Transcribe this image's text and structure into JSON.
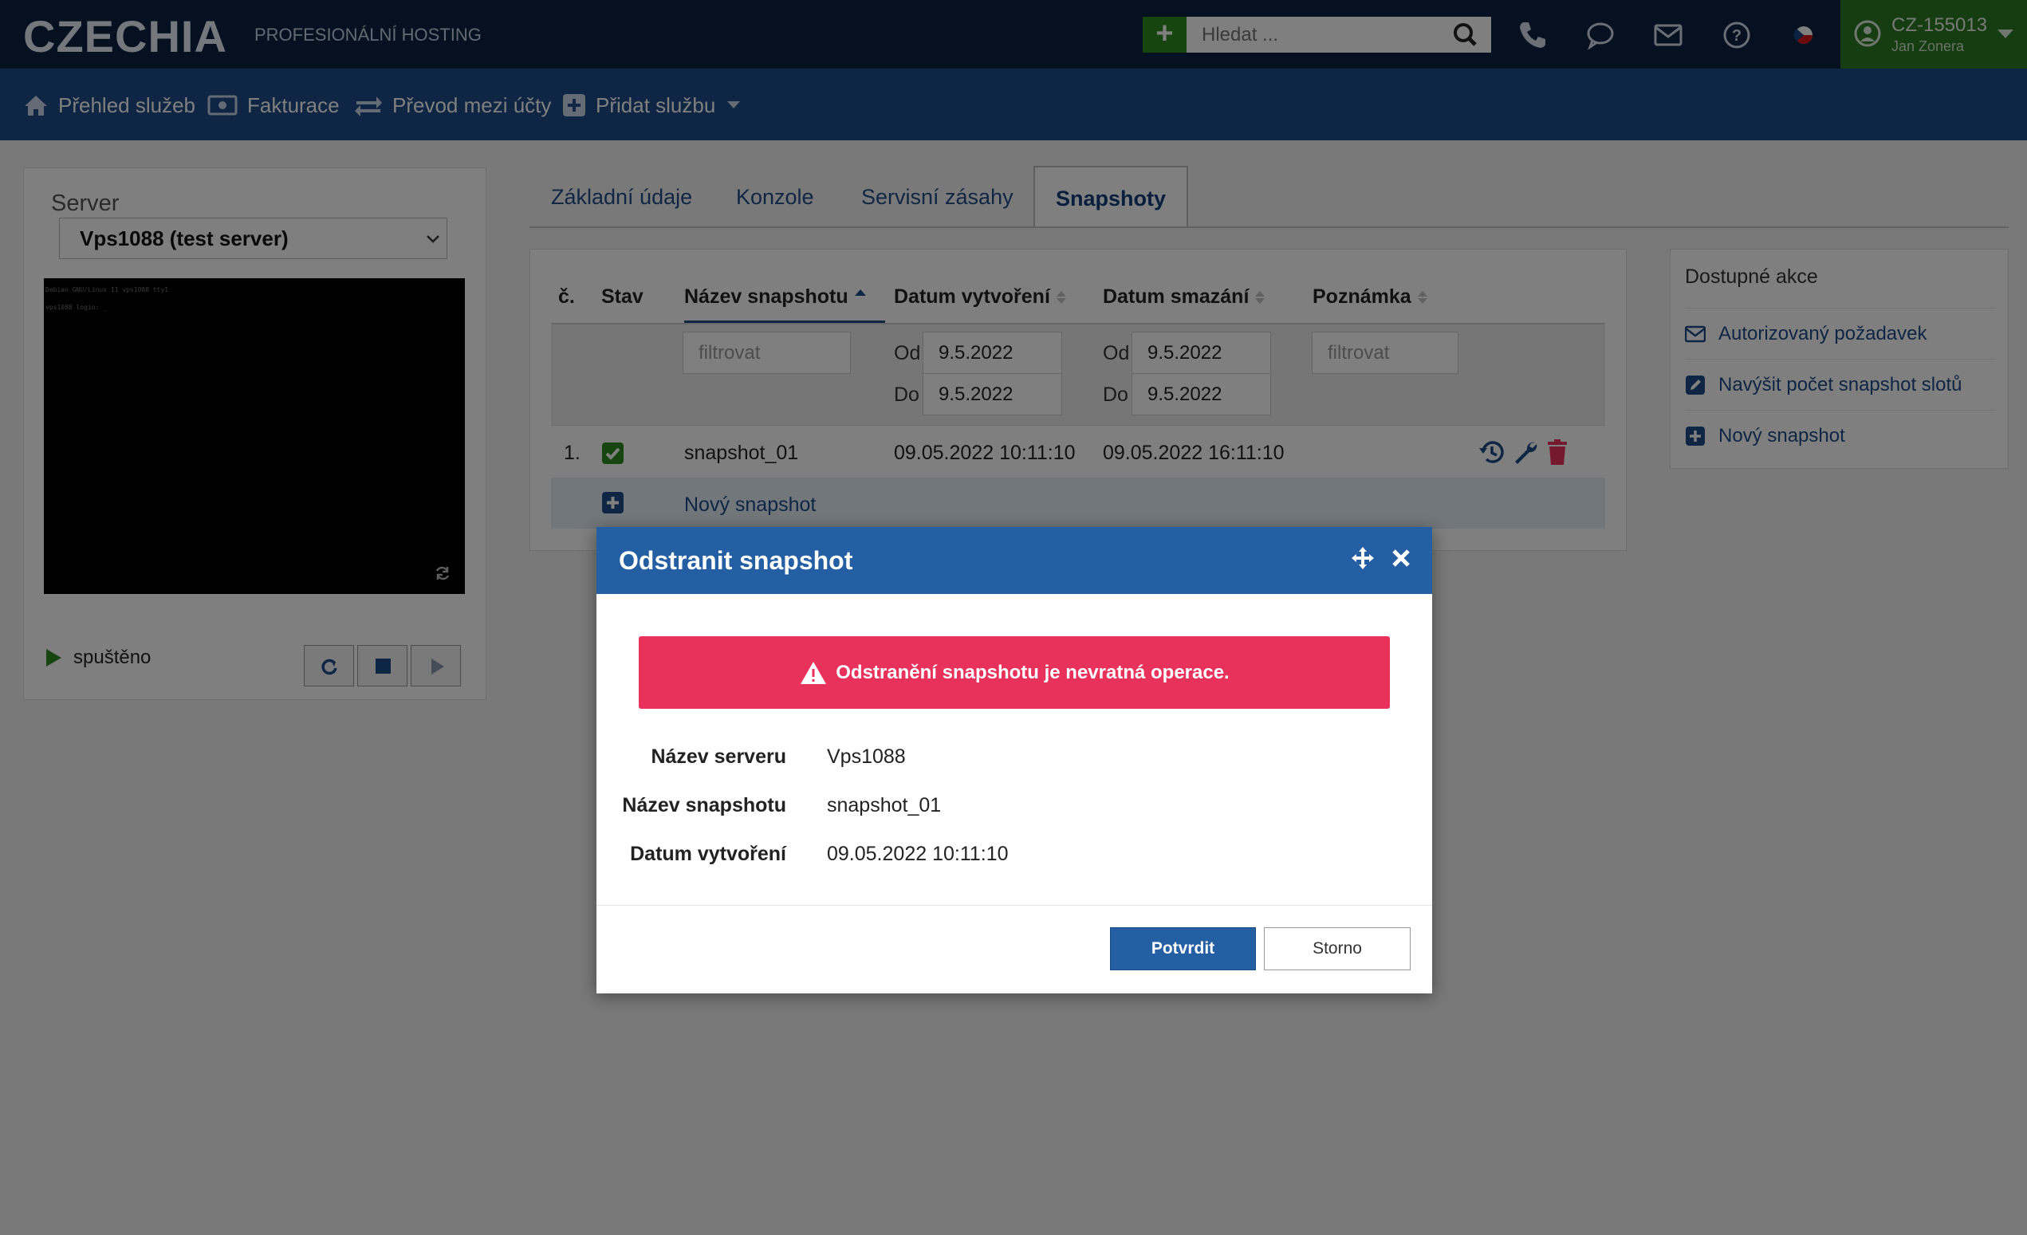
{
  "brand": {
    "name": "CZECHIA",
    "tagline": "PROFESIONÁLNÍ HOSTING"
  },
  "search": {
    "placeholder": "Hledat ..."
  },
  "account": {
    "id": "CZ-155013",
    "name": "Jan Zonera"
  },
  "subnav": {
    "overview": "Přehled služeb",
    "billing": "Fakturace",
    "transfer": "Převod mezi účty",
    "add_service": "Přidat službu"
  },
  "left_panel": {
    "server_label": "Server",
    "server_selected": "Vps1088 (test server)",
    "console_lines": [
      "Debian GNU/Linux 11 vps1088 tty1",
      "vps1088 login: _"
    ],
    "status": "spuštěno"
  },
  "tabs": [
    "Základní údaje",
    "Konzole",
    "Servisní zásahy",
    "Snapshoty"
  ],
  "table": {
    "headers": {
      "num": "č.",
      "status": "Stav",
      "name": "Název snapshotu",
      "created": "Datum vytvoření",
      "deleted": "Datum smazání",
      "note": "Poznámka"
    },
    "filter_placeholder": "filtrovat",
    "from_label": "Od",
    "to_label": "Do",
    "created_from": "9.5.2022",
    "created_to": "9.5.2022",
    "deleted_from": "9.5.2022",
    "deleted_to": "9.5.2022",
    "rows": [
      {
        "num": "1.",
        "name": "snapshot_01",
        "created": "09.05.2022 10:11:10",
        "deleted": "09.05.2022 16:11:10"
      }
    ],
    "new_row_label": "Nový snapshot"
  },
  "actions": {
    "title": "Dostupné akce",
    "items": [
      "Autorizovaný požadavek",
      "Navýšit počet snapshot slotů",
      "Nový snapshot"
    ]
  },
  "modal": {
    "title": "Odstranit snapshot",
    "alert": "Odstranění snapshotu je nevratná operace.",
    "fields": [
      {
        "key": "Název serveru",
        "value": "Vps1088"
      },
      {
        "key": "Název snapshotu",
        "value": "snapshot_01"
      },
      {
        "key": "Datum vytvoření",
        "value": "09.05.2022 10:11:10"
      }
    ],
    "confirm": "Potvrdit",
    "cancel": "Storno"
  },
  "colors": {
    "topbar": "#0b2240",
    "subnav": "#1d4a86",
    "account": "#2b7a22",
    "danger": "#e8325c",
    "primary": "#245fa3"
  }
}
